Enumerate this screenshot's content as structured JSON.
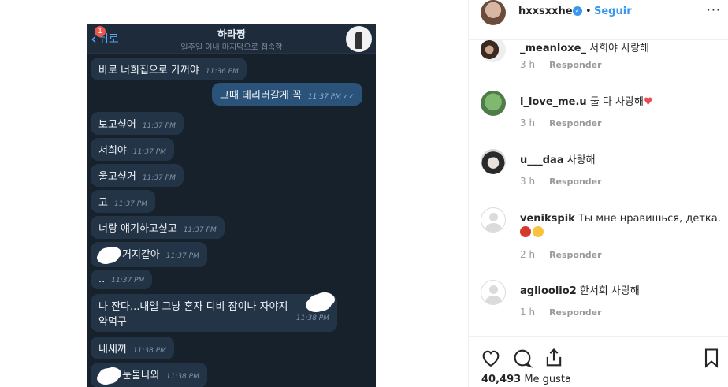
{
  "post_image": {
    "back_label": "뒤로",
    "badge": "1",
    "chat_name": "하라짱",
    "chat_status": "일주일 이내 마지막으로 접속함",
    "messages": [
      {
        "text": "바로 너희집으로 가꺼야",
        "time": "11:36 PM",
        "dir": "in"
      },
      {
        "text": "그때 데리러갈게 꼭",
        "time": "11:37 PM",
        "dir": "out"
      },
      {
        "text": "보고싶어",
        "time": "11:37 PM",
        "dir": "in"
      },
      {
        "text": "서희야",
        "time": "11:37 PM",
        "dir": "in"
      },
      {
        "text": "울고싶거",
        "time": "11:37 PM",
        "dir": "in"
      },
      {
        "text": "고",
        "time": "11:37 PM",
        "dir": "in"
      },
      {
        "text": "너랑 얘기하고싶고",
        "time": "11:37 PM",
        "dir": "in"
      },
      {
        "text": "거지같아",
        "time": "11:37 PM",
        "dir": "in"
      },
      {
        "text": "..",
        "time": "11:37 PM",
        "dir": "in"
      },
      {
        "text": "나 잔다...내일 그냥 혼자 디비 잠이나 자야지",
        "text2": "약먹구",
        "time": "11:38 PM",
        "dir": "in"
      },
      {
        "text": "내새끼",
        "time": "11:38 PM",
        "dir": "in"
      },
      {
        "text": "눈물나와",
        "time": "11:38 PM",
        "dir": "in"
      }
    ]
  },
  "post_header": {
    "username": "hxxsxxhee",
    "verified_mark": "✓",
    "separator": "•",
    "follow_label": "Seguir",
    "more_label": "···"
  },
  "comments": [
    {
      "user": "_meanloxe_",
      "text": "서희야 사랑해",
      "time": "3 h",
      "reply": "Responder"
    },
    {
      "user": "i_love_me.u",
      "text": "둘 다 사랑해",
      "time": "3 h",
      "reply": "Responder"
    },
    {
      "user": "u___daa",
      "text": "사랑해",
      "time": "3 h",
      "reply": "Responder"
    },
    {
      "user": "venikspik",
      "text": "Ты мне нравишься, детка.",
      "time": "2 h",
      "reply": "Responder"
    },
    {
      "user": "aglioolio2",
      "text": "한서희 사랑해",
      "time": "1 h",
      "reply": "Responder"
    }
  ],
  "actions": {
    "likes_count": "40,493",
    "likes_label": "Me gusta"
  },
  "colors": {
    "link_blue": "#3897f0",
    "chat_bg": "#17212b",
    "outgoing_bubble": "#2b5278",
    "incoming_bubble": "#243447",
    "heart_red": "#ed4956"
  }
}
